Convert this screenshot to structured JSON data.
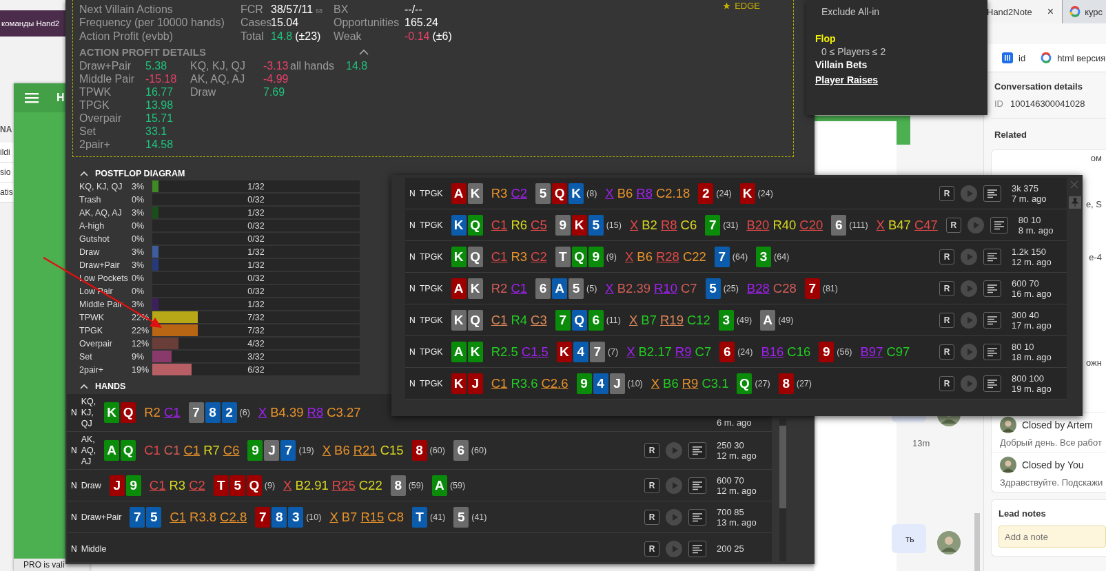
{
  "background_left": {
    "header_text": "команды Hand2",
    "table_header": "NA",
    "table_rows": [
      "ildi",
      "sio",
      "atis"
    ]
  },
  "app_window": {
    "title": "H",
    "status": "PRO is vali"
  },
  "stats": {
    "edge": "EDGE",
    "rows": [
      [
        {
          "label": "Next Villain Actions"
        },
        {
          "label": "FCR",
          "value": "38/57/11",
          "sub": "68"
        },
        {
          "label": "BX",
          "value": "--/--"
        }
      ],
      [
        {
          "label": "Frequency (per 10000 hands)"
        },
        {
          "label": "Cases",
          "value": "15.04"
        },
        {
          "label": "Opportunities",
          "value": "165.24"
        }
      ],
      [
        {
          "label": "Action Profit (evbb)"
        },
        {
          "label": "Total",
          "value": "14.8",
          "color": "#1fc27d",
          "extra": "(±23)"
        },
        {
          "label": "Weak",
          "value": "-0.14",
          "color": "#e8416a",
          "extra": "(±6)"
        }
      ]
    ]
  },
  "profit_details": {
    "title": "ACTION PROFIT DETAILS",
    "expanded": true,
    "columns": [
      [
        {
          "label": "Draw+Pair",
          "value": "5.38",
          "color": "#1fc27d"
        },
        {
          "label": "Middle Pair",
          "value": "-15.18",
          "color": "#e8416a"
        },
        {
          "label": "TPWK",
          "value": "16.77",
          "color": "#1fc27d"
        },
        {
          "label": "TPGK",
          "value": "13.98",
          "color": "#1fc27d"
        },
        {
          "label": "Overpair",
          "value": "15.71",
          "color": "#1fc27d"
        },
        {
          "label": "Set",
          "value": "33.1",
          "color": "#1fc27d"
        },
        {
          "label": "2pair+",
          "value": "14.58",
          "color": "#1fc27d"
        }
      ],
      [
        {
          "label": "KQ, KJ, QJ",
          "value": "-3.13",
          "color": "#e8416a"
        },
        {
          "label": "AK, AQ, AJ",
          "value": "-4.99",
          "color": "#e8416a"
        },
        {
          "label": "Draw",
          "value": "7.69",
          "color": "#1fc27d"
        }
      ],
      [
        {
          "label": "all hands",
          "value": "14.8",
          "color": "#1fc27d"
        }
      ]
    ]
  },
  "postflop": {
    "title": "POSTFLOP DIAGRAM",
    "expanded": true,
    "rows": [
      {
        "label": "KQ, KJ, QJ",
        "pct": "3%",
        "level": 0.031,
        "count": "1/32",
        "color": "#3f8a22"
      },
      {
        "label": "Trash",
        "pct": "0%",
        "count": "0/32"
      },
      {
        "label": "AK, AQ, AJ",
        "pct": "3%",
        "level": 0.031,
        "count": "1/32",
        "color": "#1a4f1a"
      },
      {
        "label": "A-high",
        "pct": "0%",
        "count": "0/32"
      },
      {
        "label": "Gutshot",
        "pct": "0%",
        "count": "0/32"
      },
      {
        "label": "Draw",
        "pct": "3%",
        "level": 0.031,
        "count": "1/32",
        "color": "#3f5c9e"
      },
      {
        "label": "Draw+Pair",
        "pct": "3%",
        "level": 0.031,
        "count": "1/32",
        "color": "#263a7a"
      },
      {
        "label": "Low Pockets",
        "pct": "0%",
        "count": "0/32"
      },
      {
        "label": "Low Pair",
        "pct": "0%",
        "count": "0/32"
      },
      {
        "label": "Middle Pair",
        "pct": "3%",
        "level": 0.031,
        "count": "1/32",
        "color": "#3d1f5e"
      },
      {
        "label": "TPWK",
        "pct": "22%",
        "level": 0.219,
        "count": "7/32",
        "color": "#b8a818"
      },
      {
        "label": "TPGK",
        "pct": "22%",
        "level": 0.219,
        "count": "7/32",
        "color": "#b86614"
      },
      {
        "label": "Overpair",
        "pct": "12%",
        "level": 0.125,
        "count": "4/32",
        "color": "#6a3e38"
      },
      {
        "label": "Set",
        "pct": "9%",
        "level": 0.094,
        "count": "3/32",
        "color": "#8a3a6a"
      },
      {
        "label": "2pair+",
        "pct": "19%",
        "level": 0.188,
        "count": "6/32",
        "color": "#b85f66"
      }
    ]
  },
  "hands": {
    "title": "HANDS",
    "expanded": true,
    "rows": [
      {
        "position": "N",
        "label": "KQ, KJ, QJ",
        "hole": [
          {
            "rank": "K",
            "color": "#0a8c0a"
          },
          {
            "rank": "Q",
            "color": "#9e0000"
          }
        ],
        "items": [
          {
            "kind": "actions",
            "actions": [
              {
                "text": "R2",
                "color": "#e8922a",
                "underline": false
              },
              {
                "text": "C1",
                "color": "#a020f0",
                "underline": true
              }
            ]
          },
          {
            "kind": "board",
            "cards": [
              {
                "rank": "7",
                "color": "#6b6b6b"
              },
              {
                "rank": "8",
                "color": "#0b5cad"
              },
              {
                "rank": "2",
                "color": "#0b5cad"
              }
            ],
            "pot": "(6)"
          },
          {
            "kind": "actions",
            "actions": [
              {
                "text": "X",
                "color": "#a020f0",
                "underline": true
              },
              {
                "text": "B4.39",
                "color": "#e8922a",
                "underline": false
              },
              {
                "text": "R8",
                "color": "#a020f0",
                "underline": true
              },
              {
                "text": "C3.27",
                "color": "#e8922a",
                "underline": false
              }
            ]
          }
        ],
        "time": "6 m. ago"
      },
      {
        "position": "N",
        "label": "AK, AQ, AJ",
        "hole": [
          {
            "rank": "A",
            "color": "#0a8c0a"
          },
          {
            "rank": "Q",
            "color": "#0a8c0a"
          }
        ],
        "items": [
          {
            "kind": "actions",
            "actions": [
              {
                "text": "C1",
                "color": "#e04848",
                "underline": false
              },
              {
                "text": "C1",
                "color": "#d25c58",
                "underline": false
              },
              {
                "text": "C1",
                "color": "#e8922a",
                "underline": true
              },
              {
                "text": "R7",
                "color": "#d8d820",
                "underline": false
              },
              {
                "text": "C6",
                "color": "#e8922a",
                "underline": true
              }
            ]
          },
          {
            "kind": "board",
            "cards": [
              {
                "rank": "9",
                "color": "#0a8c0a"
              },
              {
                "rank": "J",
                "color": "#6b6b6b"
              },
              {
                "rank": "7",
                "color": "#0b5cad"
              }
            ],
            "pot": "(19)"
          },
          {
            "kind": "actions",
            "actions": [
              {
                "text": "X",
                "color": "#e8922a",
                "underline": true
              },
              {
                "text": "B6",
                "color": "#e8922a",
                "underline": false
              },
              {
                "text": "R21",
                "color": "#e8922a",
                "underline": true
              },
              {
                "text": "C15",
                "color": "#d8d820",
                "underline": false
              }
            ]
          },
          {
            "kind": "board",
            "cards": [
              {
                "rank": "8",
                "color": "#9e0000"
              }
            ],
            "pot": "(60)"
          },
          {
            "kind": "board",
            "cards": [
              {
                "rank": "6",
                "color": "#6b6b6b"
              }
            ],
            "pot": "(60)"
          }
        ],
        "replay": "R",
        "stakes": "250 30",
        "time": "12 m. ago"
      },
      {
        "position": "N",
        "label": "Draw",
        "hole": [
          {
            "rank": "J",
            "color": "#9e0000"
          },
          {
            "rank": "9",
            "color": "#0a8c0a"
          }
        ],
        "items": [
          {
            "kind": "actions",
            "actions": [
              {
                "text": "C1",
                "color": "#e04848",
                "underline": true
              },
              {
                "text": "R3",
                "color": "#d8d820",
                "underline": false
              },
              {
                "text": "C2",
                "color": "#e04848",
                "underline": true
              }
            ]
          },
          {
            "kind": "board",
            "cards": [
              {
                "rank": "T",
                "color": "#9e0000"
              },
              {
                "rank": "5",
                "color": "#9e0000"
              },
              {
                "rank": "Q",
                "color": "#9e0000"
              }
            ],
            "pot": "(9)"
          },
          {
            "kind": "actions",
            "actions": [
              {
                "text": "X",
                "color": "#e04848",
                "underline": true
              },
              {
                "text": "B2.91",
                "color": "#d8d820",
                "underline": false
              },
              {
                "text": "R25",
                "color": "#e04848",
                "underline": true
              },
              {
                "text": "C22",
                "color": "#d8d820",
                "underline": false
              }
            ]
          },
          {
            "kind": "board",
            "cards": [
              {
                "rank": "8",
                "color": "#6b6b6b"
              }
            ],
            "pot": "(59)"
          },
          {
            "kind": "board",
            "cards": [
              {
                "rank": "A",
                "color": "#0a8c0a"
              }
            ],
            "pot": "(59)"
          }
        ],
        "replay": "R",
        "stakes": "600 70",
        "time": "12 m. ago"
      },
      {
        "position": "N",
        "label": "Draw+Pair",
        "hole": [
          {
            "rank": "7",
            "color": "#0b5cad"
          },
          {
            "rank": "5",
            "color": "#0b5cad"
          }
        ],
        "items": [
          {
            "kind": "actions",
            "actions": [
              {
                "text": "C1",
                "color": "#e8922a",
                "underline": true
              },
              {
                "text": "R3.8",
                "color": "#e8922a",
                "underline": false
              },
              {
                "text": "C2.8",
                "color": "#e8922a",
                "underline": true
              }
            ]
          },
          {
            "kind": "board",
            "cards": [
              {
                "rank": "7",
                "color": "#9e0000"
              },
              {
                "rank": "8",
                "color": "#0b5cad"
              },
              {
                "rank": "3",
                "color": "#0b5cad"
              }
            ],
            "pot": "(10)"
          },
          {
            "kind": "actions",
            "actions": [
              {
                "text": "X",
                "color": "#e8922a",
                "underline": true
              },
              {
                "text": "B7",
                "color": "#e8922a",
                "underline": false
              },
              {
                "text": "R15",
                "color": "#e8922a",
                "underline": true
              },
              {
                "text": "C8",
                "color": "#e8922a",
                "underline": false
              }
            ]
          },
          {
            "kind": "board",
            "cards": [
              {
                "rank": "T",
                "color": "#0b5cad"
              }
            ],
            "pot": "(41)"
          },
          {
            "kind": "board",
            "cards": [
              {
                "rank": "5",
                "color": "#6b6b6b"
              }
            ],
            "pot": "(41)"
          }
        ],
        "replay": "R",
        "stakes": "700 85",
        "time": "13 m. ago"
      },
      {
        "position": "N",
        "label": "Middle",
        "replay": "R",
        "stakes": "200 25"
      }
    ]
  },
  "popup": {
    "rows": [
      {
        "position": "N",
        "label": "TPGK",
        "hole": [
          {
            "rank": "A",
            "color": "#9e0000"
          },
          {
            "rank": "K",
            "color": "#6b6b6b"
          }
        ],
        "items": [
          {
            "kind": "actions",
            "actions": [
              {
                "text": "R3",
                "color": "#e8922a",
                "underline": false
              },
              {
                "text": "C2",
                "color": "#a020f0",
                "underline": true
              }
            ]
          },
          {
            "kind": "board",
            "cards": [
              {
                "rank": "5",
                "color": "#6b6b6b"
              },
              {
                "rank": "Q",
                "color": "#9e0000"
              },
              {
                "rank": "K",
                "color": "#0b5cad"
              }
            ],
            "pot": "(8)"
          },
          {
            "kind": "actions",
            "actions": [
              {
                "text": "X",
                "color": "#a020f0",
                "underline": true
              },
              {
                "text": "B6",
                "color": "#e8922a",
                "underline": false
              },
              {
                "text": "R8",
                "color": "#a020f0",
                "underline": true
              },
              {
                "text": "C2.18",
                "color": "#e8922a",
                "underline": false
              }
            ]
          },
          {
            "kind": "board",
            "cards": [
              {
                "rank": "2",
                "color": "#9e0000"
              }
            ],
            "pot": "(24)"
          },
          {
            "kind": "board",
            "cards": [
              {
                "rank": "K",
                "color": "#9e0000"
              }
            ],
            "pot": "(24)"
          }
        ],
        "replay": "R",
        "stakes": "3k 375",
        "time": "7 m. ago"
      },
      {
        "position": "N",
        "label": "TPGK",
        "hole": [
          {
            "rank": "K",
            "color": "#0b5cad"
          },
          {
            "rank": "Q",
            "color": "#0a8c0a"
          }
        ],
        "items": [
          {
            "kind": "actions",
            "actions": [
              {
                "text": "C1",
                "color": "#e04848",
                "underline": true
              },
              {
                "text": "R6",
                "color": "#d8d820",
                "underline": false
              },
              {
                "text": "C5",
                "color": "#e04848",
                "underline": true
              }
            ]
          },
          {
            "kind": "board",
            "cards": [
              {
                "rank": "9",
                "color": "#6b6b6b"
              },
              {
                "rank": "K",
                "color": "#9e0000"
              },
              {
                "rank": "5",
                "color": "#0b5cad"
              }
            ],
            "pot": "(15)"
          },
          {
            "kind": "actions",
            "actions": [
              {
                "text": "X",
                "color": "#e04848",
                "underline": true
              },
              {
                "text": "B2",
                "color": "#d8d820",
                "underline": false
              },
              {
                "text": "R8",
                "color": "#e04848",
                "underline": true
              },
              {
                "text": "C6",
                "color": "#d8d820",
                "underline": false
              }
            ]
          },
          {
            "kind": "board",
            "cards": [
              {
                "rank": "7",
                "color": "#0a8c0a"
              }
            ],
            "pot": "(31)"
          },
          {
            "kind": "actions",
            "actions": [
              {
                "text": "B20",
                "color": "#e04848",
                "underline": true
              },
              {
                "text": "R40",
                "color": "#d8d820",
                "underline": false
              },
              {
                "text": "C20",
                "color": "#e04848",
                "underline": true
              }
            ]
          },
          {
            "kind": "board",
            "cards": [
              {
                "rank": "6",
                "color": "#6b6b6b"
              }
            ],
            "pot": "(111)"
          },
          {
            "kind": "actions",
            "actions": [
              {
                "text": "X",
                "color": "#e04848",
                "underline": true
              },
              {
                "text": "B47",
                "color": "#d8d820",
                "underline": false
              },
              {
                "text": "C47",
                "color": "#e04848",
                "underline": true
              }
            ]
          }
        ],
        "replay": "R",
        "stakes": "80 10",
        "time": "8 m. ago"
      },
      {
        "position": "N",
        "label": "TPGK",
        "hole": [
          {
            "rank": "K",
            "color": "#0a8c0a"
          },
          {
            "rank": "Q",
            "color": "#6b6b6b"
          }
        ],
        "items": [
          {
            "kind": "actions",
            "actions": [
              {
                "text": "C1",
                "color": "#e04848",
                "underline": true
              },
              {
                "text": "R3",
                "color": "#e8922a",
                "underline": false
              },
              {
                "text": "C2",
                "color": "#e04848",
                "underline": true
              }
            ]
          },
          {
            "kind": "board",
            "cards": [
              {
                "rank": "T",
                "color": "#6b6b6b"
              },
              {
                "rank": "Q",
                "color": "#0a8c0a"
              },
              {
                "rank": "9",
                "color": "#0a8c0a"
              }
            ],
            "pot": "(9)"
          },
          {
            "kind": "actions",
            "actions": [
              {
                "text": "X",
                "color": "#e04848",
                "underline": true
              },
              {
                "text": "B6",
                "color": "#e8922a",
                "underline": false
              },
              {
                "text": "R28",
                "color": "#e04848",
                "underline": true
              },
              {
                "text": "C22",
                "color": "#e8922a",
                "underline": false
              }
            ]
          },
          {
            "kind": "board",
            "cards": [
              {
                "rank": "7",
                "color": "#0b5cad"
              }
            ],
            "pot": "(64)"
          },
          {
            "kind": "board",
            "cards": [
              {
                "rank": "3",
                "color": "#0a8c0a"
              }
            ],
            "pot": "(64)"
          }
        ],
        "replay": "R",
        "stakes": "1.2k 150",
        "time": "12 m. ago"
      },
      {
        "position": "N",
        "label": "TPGK",
        "hole": [
          {
            "rank": "A",
            "color": "#9e0000"
          },
          {
            "rank": "K",
            "color": "#6b6b6b"
          }
        ],
        "items": [
          {
            "kind": "actions",
            "actions": [
              {
                "text": "R2",
                "color": "#d25c58",
                "underline": false
              },
              {
                "text": "C1",
                "color": "#a020f0",
                "underline": true
              }
            ]
          },
          {
            "kind": "board",
            "cards": [
              {
                "rank": "6",
                "color": "#6b6b6b"
              },
              {
                "rank": "A",
                "color": "#0b5cad"
              },
              {
                "rank": "5",
                "color": "#6b6b6b"
              }
            ],
            "pot": "(5)"
          },
          {
            "kind": "actions",
            "actions": [
              {
                "text": "X",
                "color": "#a020f0",
                "underline": true
              },
              {
                "text": "B2.39",
                "color": "#d25c58",
                "underline": false
              },
              {
                "text": "R10",
                "color": "#a020f0",
                "underline": true
              },
              {
                "text": "C7",
                "color": "#d25c58",
                "underline": false
              }
            ]
          },
          {
            "kind": "board",
            "cards": [
              {
                "rank": "5",
                "color": "#0b5cad"
              }
            ],
            "pot": "(25)"
          },
          {
            "kind": "actions",
            "actions": [
              {
                "text": "B28",
                "color": "#a020f0",
                "underline": true
              },
              {
                "text": "C28",
                "color": "#d25c58",
                "underline": false
              }
            ]
          },
          {
            "kind": "board",
            "cards": [
              {
                "rank": "7",
                "color": "#9e0000"
              }
            ],
            "pot": "(81)"
          }
        ],
        "replay": "R",
        "stakes": "600 70",
        "time": "16 m. ago"
      },
      {
        "position": "N",
        "label": "TPGK",
        "hole": [
          {
            "rank": "K",
            "color": "#6b6b6b"
          },
          {
            "rank": "Q",
            "color": "#6b6b6b"
          }
        ],
        "items": [
          {
            "kind": "actions",
            "actions": [
              {
                "text": "C1",
                "color": "#dc8858",
                "underline": true
              },
              {
                "text": "R4",
                "color": "#22cc22",
                "underline": false
              },
              {
                "text": "C3",
                "color": "#dc8858",
                "underline": true
              }
            ]
          },
          {
            "kind": "board",
            "cards": [
              {
                "rank": "7",
                "color": "#0a8c0a"
              },
              {
                "rank": "Q",
                "color": "#0b5cad"
              },
              {
                "rank": "6",
                "color": "#0a8c0a"
              }
            ],
            "pot": "(11)"
          },
          {
            "kind": "actions",
            "actions": [
              {
                "text": "X",
                "color": "#dc8858",
                "underline": true
              },
              {
                "text": "B7",
                "color": "#22cc22",
                "underline": false
              },
              {
                "text": "R19",
                "color": "#dc8858",
                "underline": true
              },
              {
                "text": "C12",
                "color": "#22cc22",
                "underline": false
              }
            ]
          },
          {
            "kind": "board",
            "cards": [
              {
                "rank": "3",
                "color": "#0a8c0a"
              }
            ],
            "pot": "(49)"
          },
          {
            "kind": "board",
            "cards": [
              {
                "rank": "A",
                "color": "#6b6b6b"
              }
            ],
            "pot": "(49)"
          }
        ],
        "replay": "R",
        "stakes": "300 40",
        "time": "17 m. ago"
      },
      {
        "position": "N",
        "label": "TPGK",
        "hole": [
          {
            "rank": "A",
            "color": "#0a8c0a"
          },
          {
            "rank": "K",
            "color": "#0a8c0a"
          }
        ],
        "items": [
          {
            "kind": "actions",
            "actions": [
              {
                "text": "R2.5",
                "color": "#22cc22",
                "underline": false
              },
              {
                "text": "C1.5",
                "color": "#a020f0",
                "underline": true
              }
            ]
          },
          {
            "kind": "board",
            "cards": [
              {
                "rank": "K",
                "color": "#9e0000"
              },
              {
                "rank": "4",
                "color": "#0b5cad"
              },
              {
                "rank": "7",
                "color": "#6b6b6b"
              }
            ],
            "pot": "(7)"
          },
          {
            "kind": "actions",
            "actions": [
              {
                "text": "X",
                "color": "#a020f0",
                "underline": true
              },
              {
                "text": "B2.17",
                "color": "#22cc22",
                "underline": false
              },
              {
                "text": "R9",
                "color": "#a020f0",
                "underline": true
              },
              {
                "text": "C7",
                "color": "#22cc22",
                "underline": false
              }
            ]
          },
          {
            "kind": "board",
            "cards": [
              {
                "rank": "6",
                "color": "#9e0000"
              }
            ],
            "pot": "(24)"
          },
          {
            "kind": "actions",
            "actions": [
              {
                "text": "B16",
                "color": "#a020f0",
                "underline": true
              },
              {
                "text": "C16",
                "color": "#22cc22",
                "underline": false
              }
            ]
          },
          {
            "kind": "board",
            "cards": [
              {
                "rank": "9",
                "color": "#9e0000"
              }
            ],
            "pot": "(56)"
          },
          {
            "kind": "actions",
            "actions": [
              {
                "text": "B97",
                "color": "#a020f0",
                "underline": true
              },
              {
                "text": "C97",
                "color": "#22cc22",
                "underline": false
              }
            ]
          }
        ],
        "replay": "R",
        "stakes": "80 10",
        "time": "18 m. ago"
      },
      {
        "position": "N",
        "label": "TPGK",
        "hole": [
          {
            "rank": "K",
            "color": "#9e0000"
          },
          {
            "rank": "J",
            "color": "#9e0000"
          }
        ],
        "items": [
          {
            "kind": "actions",
            "actions": [
              {
                "text": "C1",
                "color": "#e8922a",
                "underline": true
              },
              {
                "text": "R3.6",
                "color": "#22cc22",
                "underline": false
              },
              {
                "text": "C2.6",
                "color": "#e8922a",
                "underline": true
              }
            ]
          },
          {
            "kind": "board",
            "cards": [
              {
                "rank": "9",
                "color": "#0a8c0a"
              },
              {
                "rank": "4",
                "color": "#0b5cad"
              },
              {
                "rank": "J",
                "color": "#6b6b6b"
              }
            ],
            "pot": "(10)"
          },
          {
            "kind": "actions",
            "actions": [
              {
                "text": "X",
                "color": "#e8922a",
                "underline": true
              },
              {
                "text": "B6",
                "color": "#22cc22",
                "underline": false
              },
              {
                "text": "R9",
                "color": "#e8922a",
                "underline": true
              },
              {
                "text": "C3.1",
                "color": "#22cc22",
                "underline": false
              }
            ]
          },
          {
            "kind": "board",
            "cards": [
              {
                "rank": "Q",
                "color": "#0a8c0a"
              }
            ],
            "pot": "(27)"
          },
          {
            "kind": "board",
            "cards": [
              {
                "rank": "8",
                "color": "#9e0000"
              }
            ],
            "pot": "(27)"
          }
        ],
        "replay": "R",
        "stakes": "800 100",
        "time": "19 m. ago"
      }
    ]
  },
  "filter_menu": {
    "lines": [
      {
        "kind": "option",
        "text": "Exclude All-in"
      },
      {
        "kind": "street",
        "text": "Flop"
      },
      {
        "kind": "range",
        "text": "0 ≤ Players ≤ 2"
      },
      {
        "kind": "filter",
        "text": "Villain Bets"
      },
      {
        "kind": "link",
        "text": "Player Raises"
      }
    ]
  },
  "browser": {
    "tabs": [
      {
        "title": "Hand2Note",
        "close": "×"
      },
      {
        "title": "курс"
      }
    ],
    "bookmarks": [
      "id",
      "html версия"
    ]
  },
  "chat": {
    "time": "13m",
    "bubble": "ть"
  },
  "details": {
    "title": "Conversation details",
    "id_label": "ID",
    "id_value": "100146300041028",
    "related_title": "Related",
    "related_fragments": [
      "ом",
      "е, S",
      "е-4",
      "ожн"
    ],
    "conversations": [
      {
        "title": "Closed by Artem",
        "preview": "Добрый день. Все работ"
      },
      {
        "title": "Closed by You",
        "preview": "Здравствуйте. Подскажи"
      }
    ],
    "notes_title": "Lead notes",
    "notes_placeholder": "Add a note"
  }
}
